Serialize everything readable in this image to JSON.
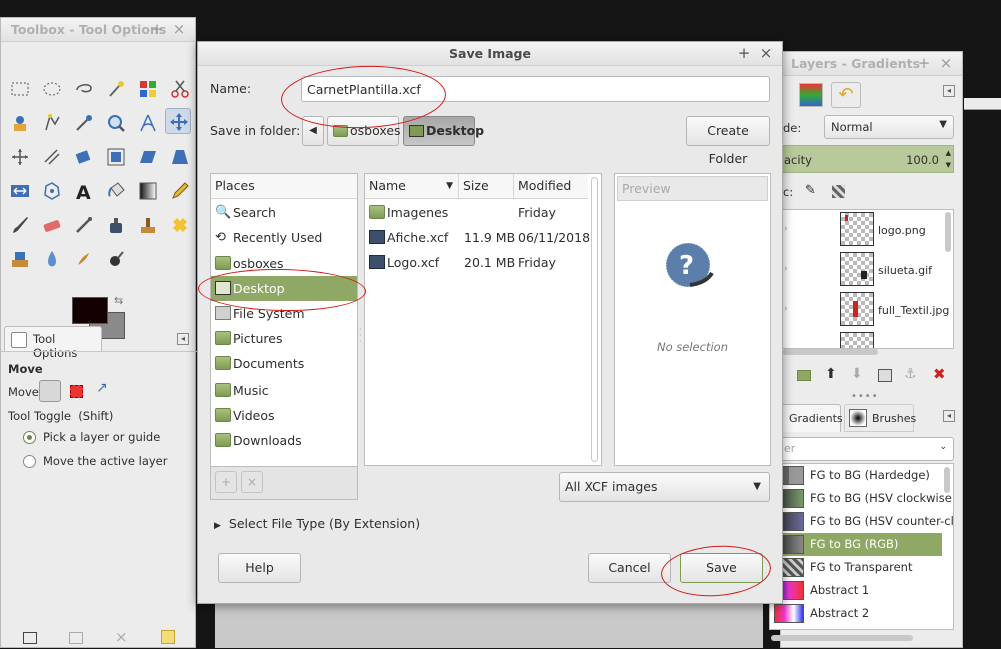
{
  "toolbox": {
    "title": "Toolbox - Tool Options",
    "tool_options_tab": "Tool Options",
    "move_heading": "Move",
    "move_label": "Move:",
    "tool_toggle": "Tool Toggle  (Shift)",
    "option_pick": "Pick a layer or guide",
    "option_move_active": "Move the active layer",
    "selected_option": "Pick a layer or guide"
  },
  "dialog": {
    "title": "Save Image",
    "name_label": "Name:",
    "name_value": "CarnetPlantilla.xcf",
    "save_in_label": "Save in folder:",
    "breadcrumbs": [
      "osboxes",
      "Desktop"
    ],
    "create_folder": "Create Folder",
    "places_header": "Places",
    "places": [
      "Search",
      "Recently Used",
      "osboxes",
      "Desktop",
      "File System",
      "Pictures",
      "Documents",
      "Music",
      "Videos",
      "Downloads"
    ],
    "selected_place": "Desktop",
    "columns": {
      "name": "Name",
      "size": "Size",
      "modified": "Modified"
    },
    "files": [
      {
        "name": "Imagenes",
        "size": "",
        "modified": "Friday",
        "kind": "folder"
      },
      {
        "name": "Afiche.xcf",
        "size": "11.9 MB",
        "modified": "06/11/2018",
        "kind": "xcf"
      },
      {
        "name": "Logo.xcf",
        "size": "20.1 MB",
        "modified": "Friday",
        "kind": "xcf"
      }
    ],
    "preview_header": "Preview",
    "no_selection": "No selection",
    "filter": "All XCF images",
    "file_type_expander": "Select File Type (By Extension)",
    "help": "Help",
    "cancel": "Cancel",
    "save": "Save"
  },
  "layers": {
    "title": "Layers - Gradients",
    "mode_label": "de:",
    "mode_value": "Normal",
    "opacity_label": "acity",
    "opacity_value": "100.0",
    "lock_label": "c:",
    "items": [
      "logo.png",
      "silueta.gif",
      "full_Textil.jpg"
    ]
  },
  "gradients": {
    "tab_gradients": "Gradients",
    "tab_brushes": "Brushes",
    "filter_placeholder": "er",
    "items": [
      "FG to BG (Hardedge)",
      "FG to BG (HSV clockwise hue)",
      "FG to BG (HSV counter-clockwise)",
      "FG to BG (RGB)",
      "FG to Transparent",
      "Abstract 1",
      "Abstract 2"
    ],
    "selected": "FG to BG (RGB)"
  },
  "colors": {
    "selection_green": "#8fa865",
    "annotation_red": "#d21b1b",
    "fg_color": "#140000",
    "bg_color": "#8a8a8a"
  }
}
